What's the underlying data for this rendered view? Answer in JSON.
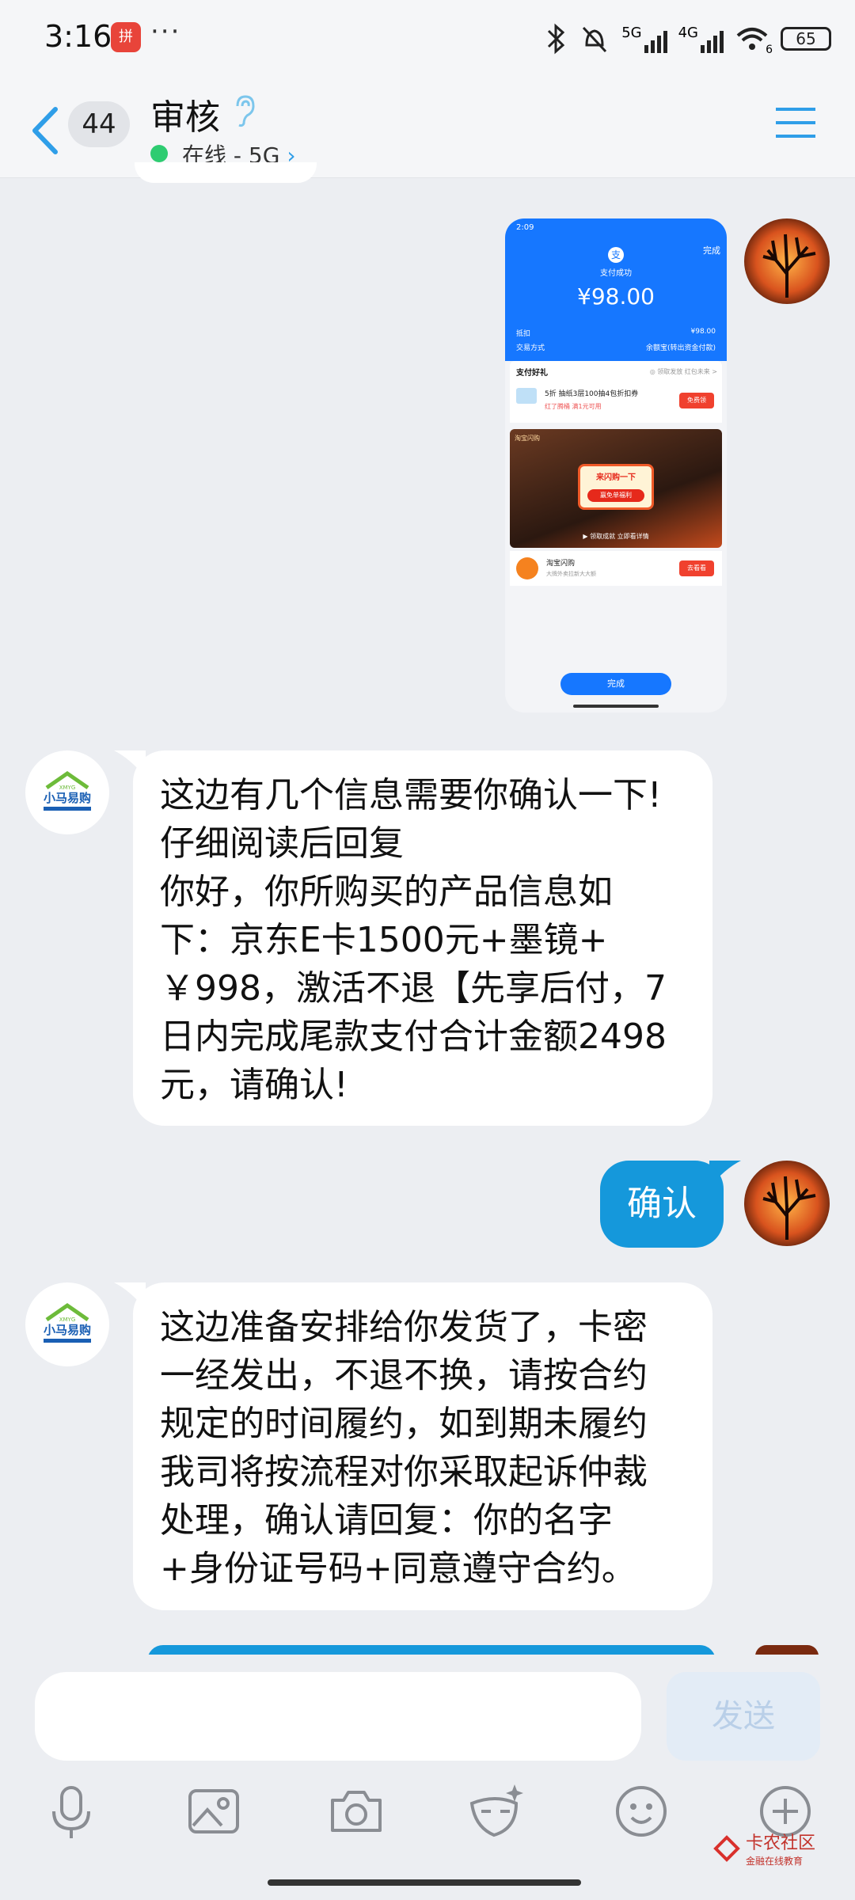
{
  "status": {
    "time": "3:16",
    "app_badge": "拼",
    "more": "···",
    "net1": "5G",
    "net2": "4G",
    "wifi_level": "6",
    "battery": "65"
  },
  "header": {
    "unread_count": "44",
    "contact_name": "审核",
    "online_status": "在线 - 5G"
  },
  "image_message": {
    "time": "2:09",
    "done_top": "完成",
    "title": "支付成功",
    "amount": "¥98.00",
    "row1_label": "抵扣",
    "row1_value": "¥98.00",
    "row2_label": "交易方式",
    "row2_value": "余额宝(转出资金付款)",
    "section": "支付好礼",
    "section_right": "◎ 领取发放 红包未来 >",
    "coupon_text": "5折 抽纸3层100抽4包折扣券",
    "coupon_sub": "红了腾桶  满1元可用",
    "coupon_btn": "免费领",
    "banner_line1": "来闪购一下",
    "banner_line2": "赢免单福利",
    "banner_bottom": "▶ 领取成就 立即看详情",
    "brand_tag": "淘宝闪购",
    "ad_title": "淘宝闪购",
    "ad_sub": "大牌外卖拉新大大额",
    "ad_btn": "去看看",
    "done_btn": "完成"
  },
  "messages": {
    "m1_lines": [
      "这边有几个信息需要你确认一下!",
      "仔细阅读后回复",
      "你好，你所购买的产品信息如",
      "下：京东E卡1500元+墨镜+",
      "￥998，激活不退【先享后付，7",
      "日内完成尾款支付合计金额2498",
      "元，请确认!"
    ],
    "m2": "确认",
    "m3_lines": [
      "这边准备安排给你发货了，卡密",
      "一经发出，不退不换，请按合约",
      "规定的时间履约，如到期未履约",
      "我司将按流程对你采取起诉仲裁",
      "处理，确认请回复：你的名字",
      "+身份证号码+同意遵守合约。"
    ]
  },
  "bot_logo": {
    "top": "XMYG",
    "main": "小马易购"
  },
  "input": {
    "placeholder": "",
    "send_label": "发送"
  },
  "watermark": {
    "title": "卡农社区",
    "sub": "金融在线教育"
  },
  "colors": {
    "accent": "#1598db",
    "online": "#2ecc71",
    "bg": "#eceef2"
  }
}
